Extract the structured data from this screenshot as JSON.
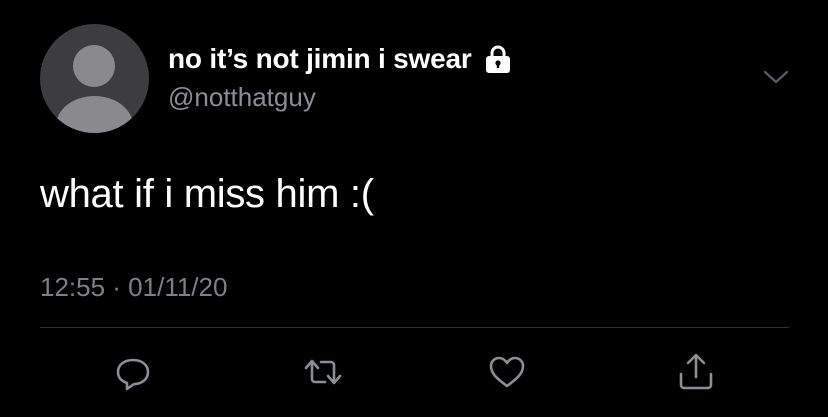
{
  "tweet": {
    "display_name": "no it’s not jimin i swear",
    "handle": "@notthatguy",
    "protected_icon": "lock-icon",
    "menu_icon": "chevron-down-icon",
    "text": "what if i miss him :(",
    "timestamp": "12:55 · 01/11/20"
  },
  "actions": [
    {
      "name": "reply",
      "icon": "reply-icon"
    },
    {
      "name": "retweet",
      "icon": "retweet-icon"
    },
    {
      "name": "like",
      "icon": "heart-icon"
    },
    {
      "name": "share",
      "icon": "share-icon"
    }
  ],
  "colors": {
    "background": "#000000",
    "primary_text": "#ffffff",
    "secondary_text": "#8b8e93",
    "icon": "#8b8e93",
    "divider": "#2f3336",
    "avatar_bg": "#3d3d3f",
    "avatar_fg": "#8a8a8e"
  }
}
